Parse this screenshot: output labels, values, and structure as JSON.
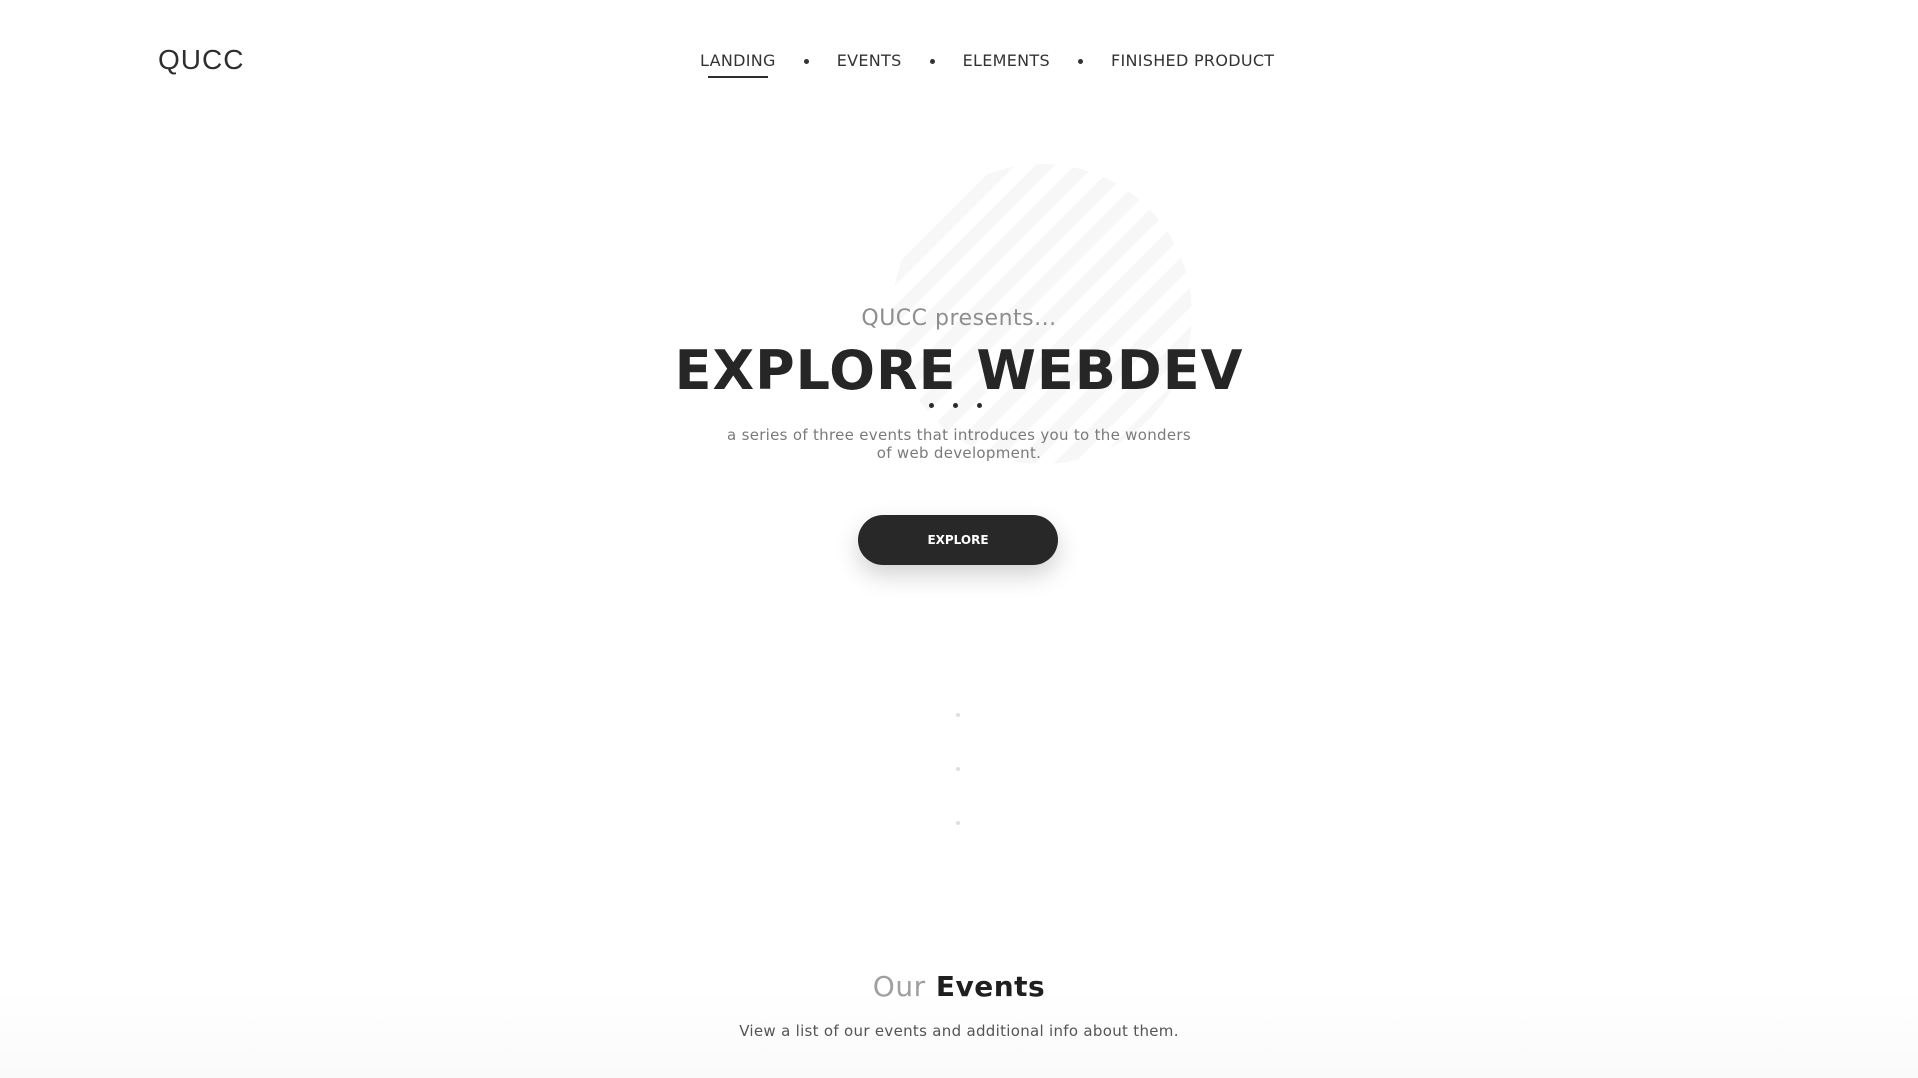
{
  "header": {
    "logo": "QUCC",
    "nav": [
      {
        "label": "LANDING",
        "active": true
      },
      {
        "label": "EVENTS",
        "active": false
      },
      {
        "label": "ELEMENTS",
        "active": false
      },
      {
        "label": "FINISHED PRODUCT",
        "active": false
      }
    ]
  },
  "hero": {
    "pre_title": "QUCC presents...",
    "title": "EXPLORE WEBDEV",
    "subtitle": "a series of three events that introduces you to the wonders of web development.",
    "button_label": "EXPLORE"
  },
  "events_section": {
    "title_light": "Our",
    "title_bold": "Events",
    "subtitle": "View a list of our events and additional info about them."
  },
  "colors": {
    "text_dark": "#2b2b2b",
    "button_bg": "#282828",
    "muted": "#8e8e8e"
  }
}
